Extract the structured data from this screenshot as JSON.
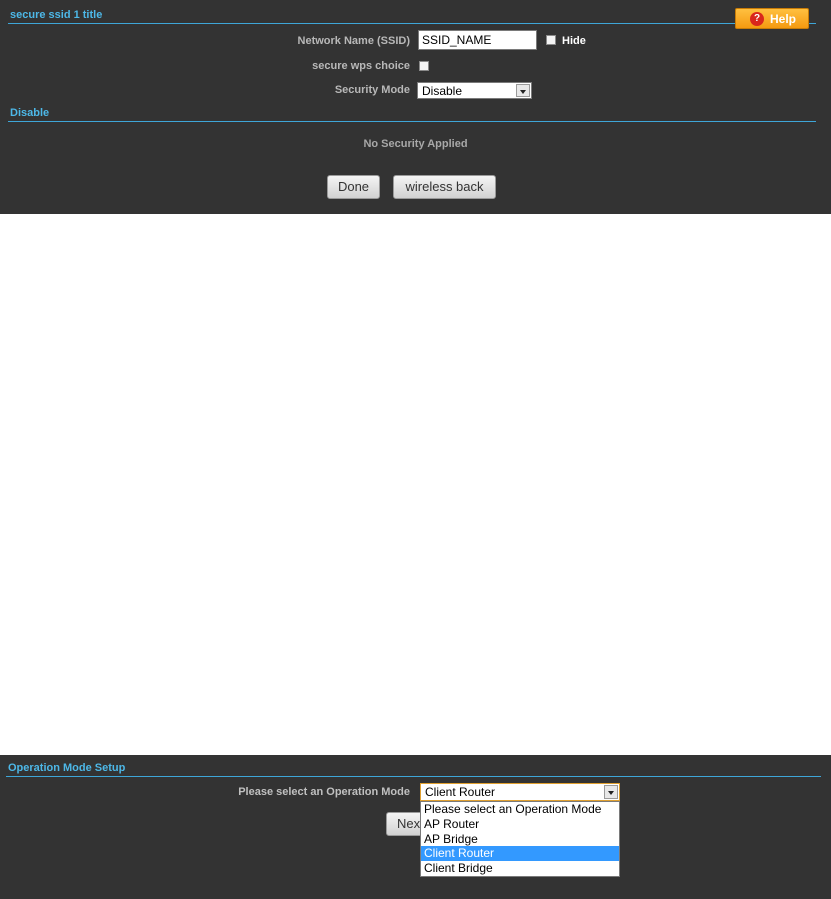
{
  "top": {
    "section_title": "secure ssid 1 title",
    "help_label": "Help",
    "ssid_label": "Network Name (SSID)",
    "ssid_value": "SSID_NAME",
    "hide_label": "Hide",
    "wps_label": "secure wps choice",
    "security_mode_label": "Security Mode",
    "security_mode_value": "Disable",
    "sub_section_title": "Disable",
    "no_security_text": "No Security Applied",
    "done_label": "Done",
    "wireless_back_label": "wireless back"
  },
  "bottom": {
    "section_title": "Operation Mode Setup",
    "op_mode_label": "Please select an Operation Mode",
    "op_mode_value": "Client Router",
    "next_label": "Nex",
    "options": [
      "Please select an Operation Mode",
      "AP Router",
      "AP Bridge",
      "Client Router",
      "Client Bridge"
    ],
    "selected_option": "Client Router"
  },
  "colors": {
    "panel_bg": "#333333",
    "title_color": "#4db8e8",
    "help_button": "#f59a10",
    "highlight": "#3399ff"
  }
}
